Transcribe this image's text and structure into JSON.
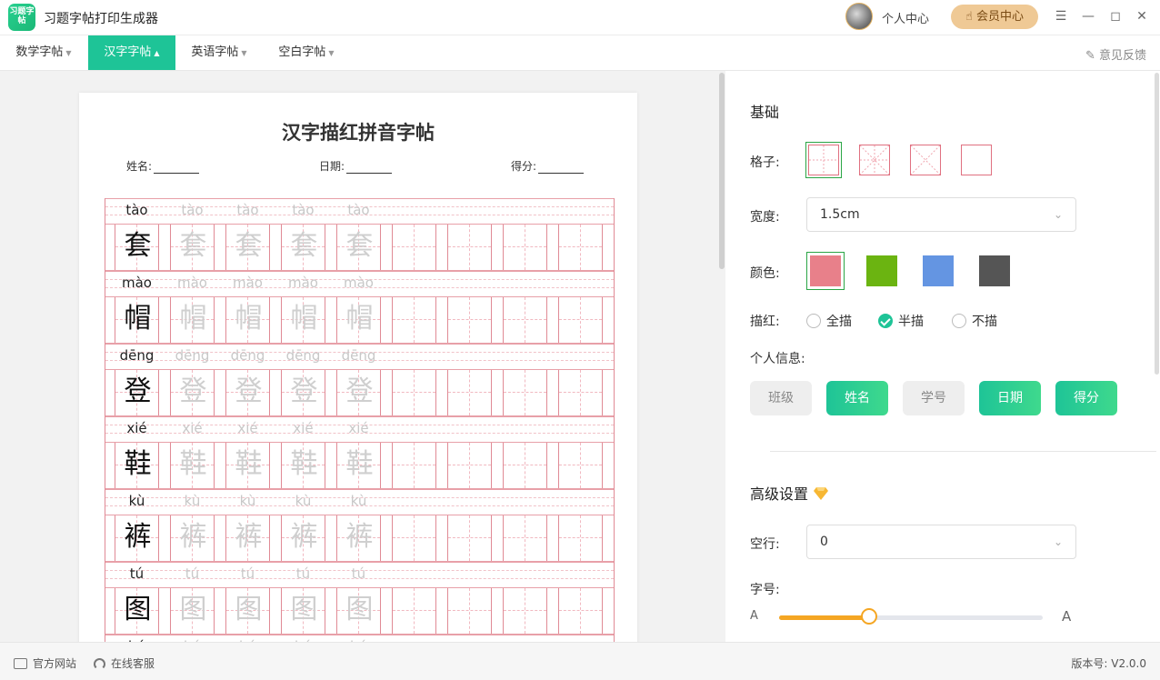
{
  "app": {
    "title": "习题字帖打印生成器",
    "logo_text": "习题字帖"
  },
  "header": {
    "personal_center": "个人中心",
    "vip_center": "会员中心"
  },
  "tabs": [
    {
      "label": "数学字帖",
      "active": false
    },
    {
      "label": "汉字字帖",
      "active": true
    },
    {
      "label": "英语字帖",
      "active": false
    },
    {
      "label": "空白字帖",
      "active": false
    }
  ],
  "feedback_label": "意见反馈",
  "sheet": {
    "title": "汉字描红拼音字帖",
    "name_label": "姓名:",
    "date_label": "日期:",
    "score_label": "得分:",
    "rows": [
      {
        "pinyin": "tào",
        "char": "套"
      },
      {
        "pinyin": "mào",
        "char": "帽"
      },
      {
        "pinyin": "dēng",
        "char": "登"
      },
      {
        "pinyin": "xié",
        "char": "鞋"
      },
      {
        "pinyin": "kù",
        "char": "裤"
      },
      {
        "pinyin": "tú",
        "char": "图"
      },
      {
        "pinyin": "hú",
        "char": ""
      }
    ]
  },
  "settings": {
    "basic_title": "基础",
    "grid_label": "格子:",
    "width_label": "宽度:",
    "width_value": "1.5cm",
    "color_label": "颜色:",
    "colors": [
      "#e8808a",
      "#6bb411",
      "#6495e2",
      "#555555"
    ],
    "trace_label": "描红:",
    "trace_options": [
      {
        "label": "全描",
        "selected": false
      },
      {
        "label": "半描",
        "selected": true
      },
      {
        "label": "不描",
        "selected": false
      }
    ],
    "personal_info_label": "个人信息:",
    "personal_info_options": [
      {
        "label": "班级",
        "on": false
      },
      {
        "label": "姓名",
        "on": true
      },
      {
        "label": "学号",
        "on": false
      },
      {
        "label": "日期",
        "on": true
      },
      {
        "label": "得分",
        "on": true
      }
    ],
    "advanced_title": "高级设置",
    "blank_rows_label": "空行:",
    "blank_rows_value": "0",
    "font_size_label": "字号:",
    "font_size_small": "A",
    "font_size_large": "A",
    "font_size_level": 0.34
  },
  "footer": {
    "website": "官方网站",
    "support": "在线客服",
    "version": "版本号: V2.0.0"
  }
}
